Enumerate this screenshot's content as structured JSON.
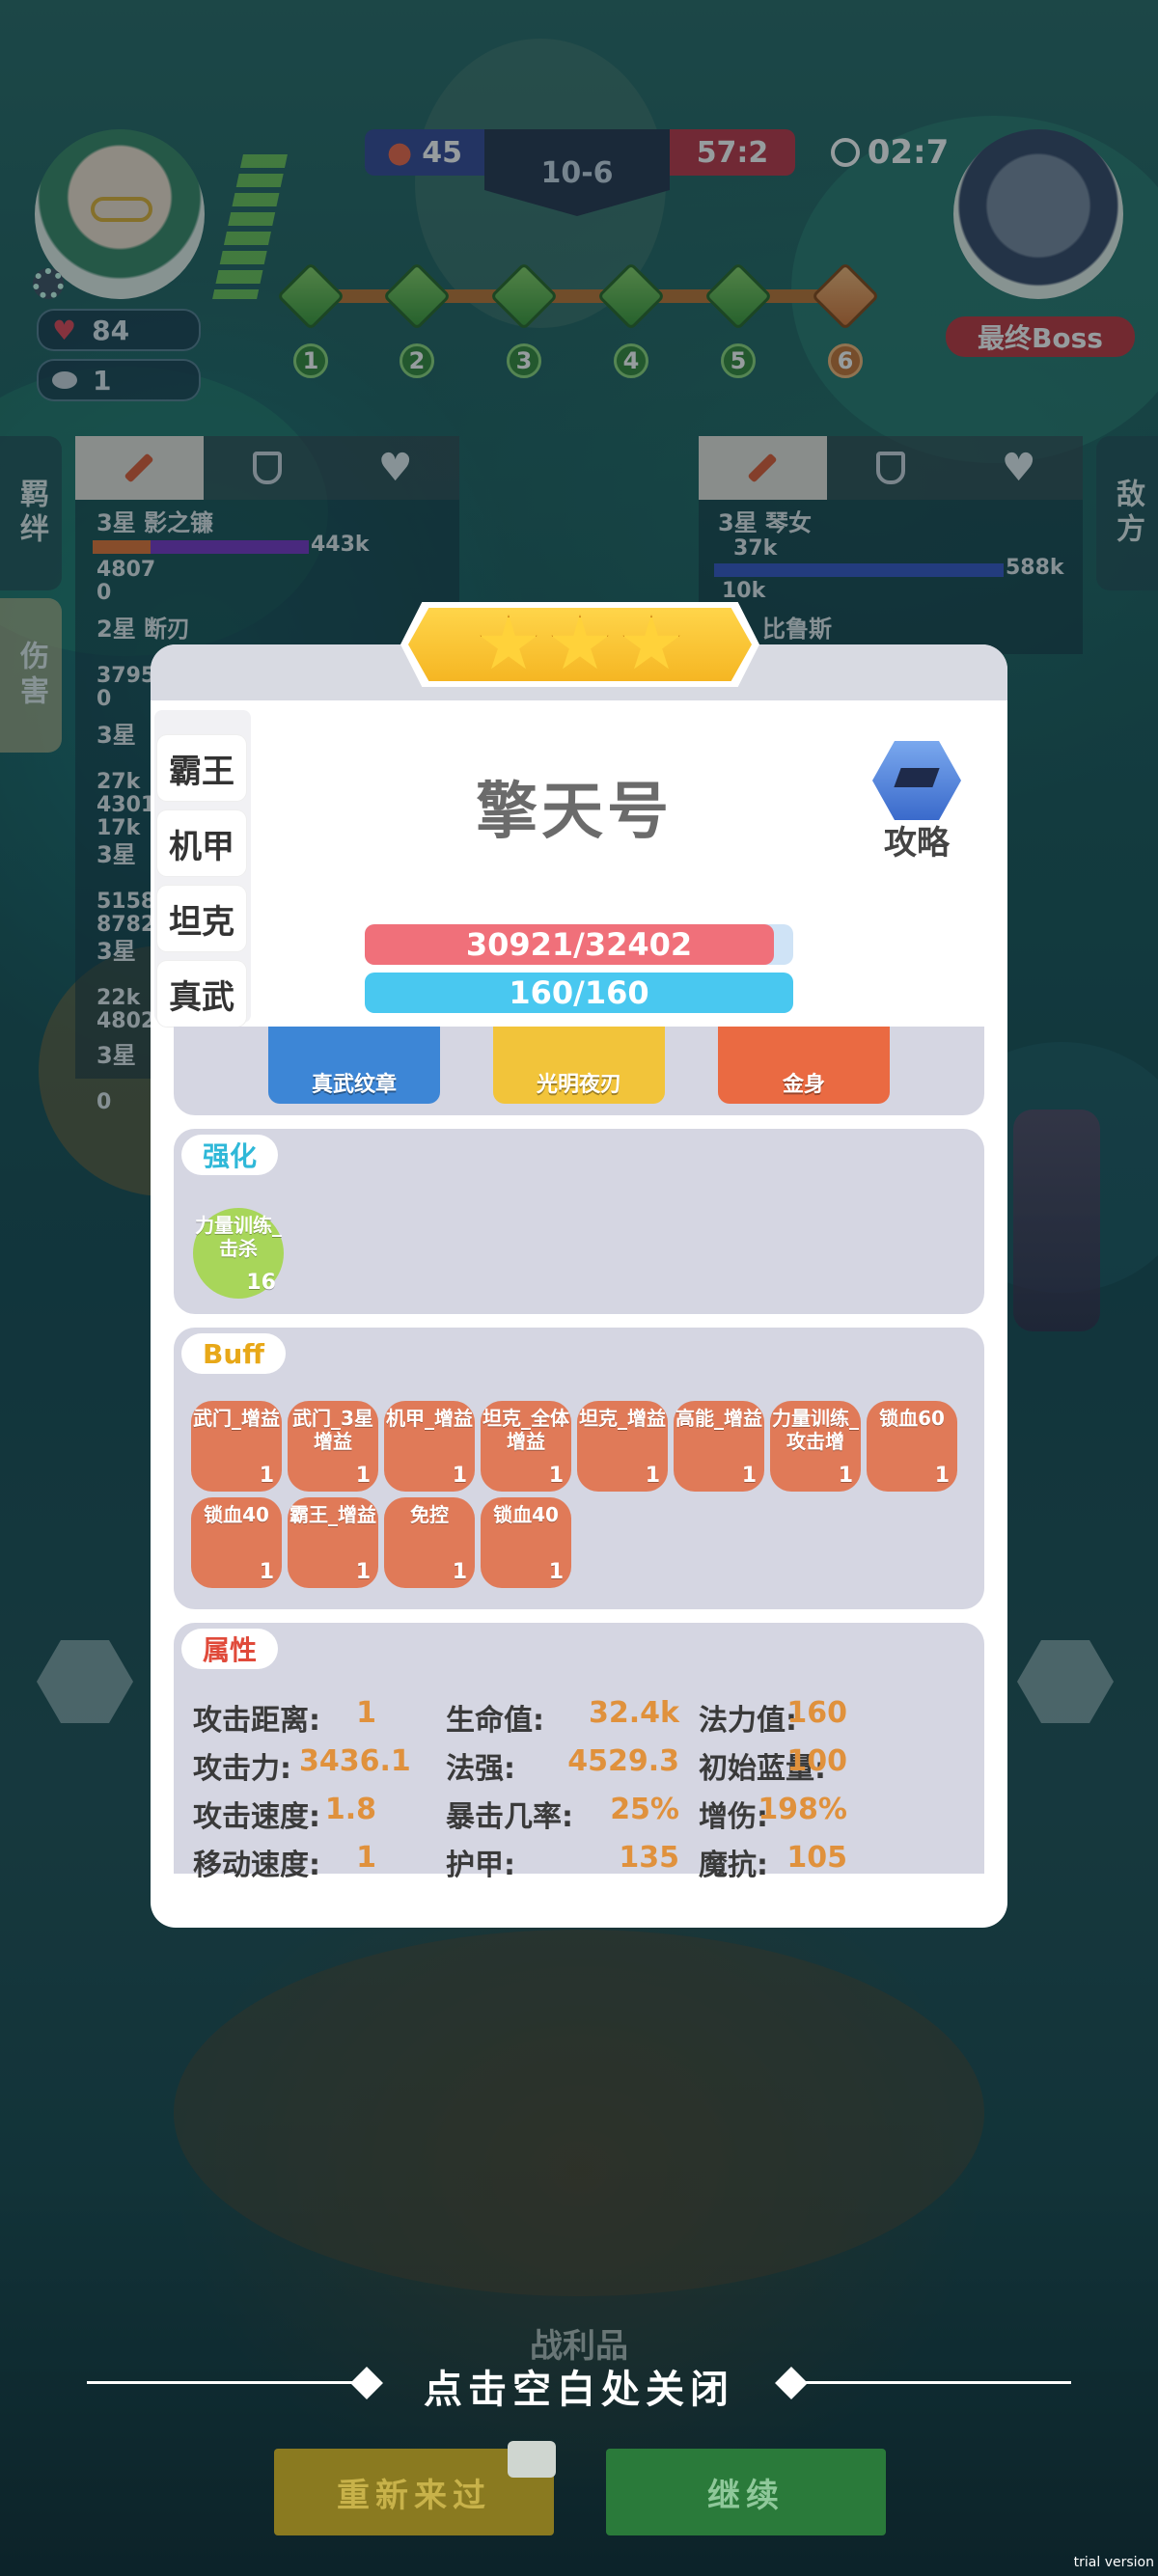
{
  "hud": {
    "left_score": "45",
    "round": "10-6",
    "right_score": "57:2",
    "timer": "02:7",
    "hearts": "84",
    "coins": "1",
    "boss_label": "最终Boss",
    "stages": [
      "1",
      "2",
      "3",
      "4",
      "5",
      "6"
    ]
  },
  "left_panel": {
    "side_tab_top": "羁绊",
    "side_tab_bottom": "伤害",
    "rows": [
      {
        "name": "3星 影之镰",
        "value": "443k",
        "sub": "4807",
        "sub2": "0"
      },
      {
        "name": "2星 断刃",
        "value": "",
        "sub": "3795",
        "sub2": "0"
      },
      {
        "name": "3星",
        "value": "",
        "sub": "27k",
        "sub2": "4301"
      },
      {
        "name": "",
        "value": "",
        "sub": "17k",
        "sub2": ""
      },
      {
        "name": "3星",
        "value": "",
        "sub": "5158",
        "sub2": "8782"
      },
      {
        "name": "3星",
        "value": "",
        "sub": "22k",
        "sub2": "4802"
      },
      {
        "name": "3星",
        "value": "",
        "sub": "0",
        "sub2": ""
      }
    ]
  },
  "right_panel": {
    "side_tab": "敌方",
    "rows": [
      {
        "name": "3星 琴女",
        "value": "37k",
        "value2": "588k",
        "sub": "10k"
      },
      {
        "name": "比鲁斯",
        "value": "",
        "value2": "",
        "sub": ""
      }
    ]
  },
  "modal": {
    "stars": 3,
    "tags": [
      "霸王",
      "机甲",
      "坦克",
      "真武"
    ],
    "name": "擎天号",
    "guide_label": "攻略",
    "hp_text": "30921/32402",
    "hp_fraction": 0.954,
    "mp_text": "160/160",
    "mp_fraction": 1.0,
    "equipment": [
      {
        "name": "真武纹章",
        "color": "#3d86d6"
      },
      {
        "name": "光明夜刃",
        "color": "#f2c43a"
      },
      {
        "name": "金身",
        "color": "#ea6a42"
      }
    ],
    "enhance": {
      "title": "强化",
      "items": [
        {
          "name": "力量训练_击杀",
          "count": "16"
        }
      ]
    },
    "buff": {
      "title": "Buff",
      "items": [
        {
          "name": "武门_增益",
          "count": "1"
        },
        {
          "name": "武门_3星增益",
          "count": "1"
        },
        {
          "name": "机甲_增益",
          "count": "1"
        },
        {
          "name": "坦克_全体增益",
          "count": "1"
        },
        {
          "name": "坦克_增益",
          "count": "1"
        },
        {
          "name": "高能_增益",
          "count": "1"
        },
        {
          "name": "力量训练_攻击增",
          "count": "1"
        },
        {
          "name": "锁血60",
          "count": "1"
        },
        {
          "name": "锁血40",
          "count": "1"
        },
        {
          "name": "霸王_增益",
          "count": "1"
        },
        {
          "name": "免控",
          "count": "1"
        },
        {
          "name": "锁血40",
          "count": "1"
        }
      ]
    },
    "attributes": {
      "title": "属性",
      "rows": [
        [
          {
            "k": "攻击距离:",
            "v": "1"
          },
          {
            "k": "生命值:",
            "v": "32.4k"
          },
          {
            "k": "法力值:",
            "v": "160"
          }
        ],
        [
          {
            "k": "攻击力:",
            "v": "3436.1"
          },
          {
            "k": "法强:",
            "v": "4529.3"
          },
          {
            "k": "初始蓝量:",
            "v": "100"
          }
        ],
        [
          {
            "k": "攻击速度:",
            "v": "1.8"
          },
          {
            "k": "暴击几率:",
            "v": "25%"
          },
          {
            "k": "增伤:",
            "v": "198%"
          }
        ],
        [
          {
            "k": "移动速度:",
            "v": "1"
          },
          {
            "k": "护甲:",
            "v": "135"
          },
          {
            "k": "魔抗:",
            "v": "105"
          }
        ]
      ]
    }
  },
  "footer": {
    "close_hint": "点击空白处关闭",
    "loot_label": "战利品",
    "retry": "重新来过",
    "continue": "继续",
    "watermark": "trial version"
  },
  "colors": {
    "hp": "#f0707a",
    "mp": "#49c8f0",
    "buff": "#e07a58",
    "enhance": "#a8d65a",
    "attr_value": "#e0913c",
    "enhance_title": "#2fb8d8",
    "buff_title": "#e8a818",
    "attr_title": "#e04a3a"
  }
}
